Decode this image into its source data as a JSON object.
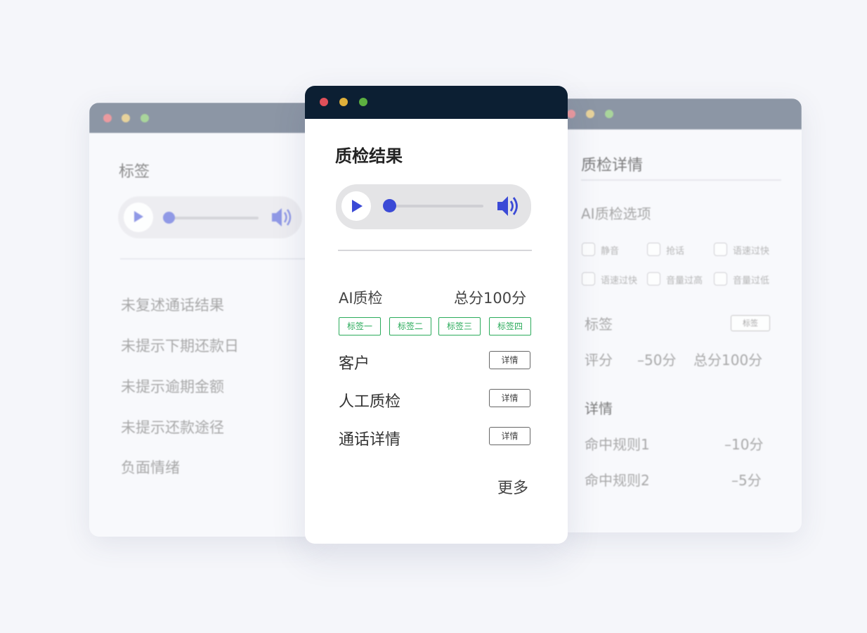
{
  "left_window": {
    "title": "标签",
    "items": [
      "未复述通话结果",
      "未提示下期还款日",
      "未提示逾期金额",
      "未提示还款途径",
      "负面情绪"
    ],
    "player_progress": 0.0
  },
  "center_window": {
    "title": "质检结果",
    "player_progress": 0.0,
    "ai_label": "AI质检",
    "total_score": "总分100分",
    "tags": [
      "标签一",
      "标签二",
      "标签三",
      "标签四"
    ],
    "rows": [
      {
        "label": "客户",
        "button": "详情"
      },
      {
        "label": "人工质检",
        "button": "详情"
      },
      {
        "label": "通话详情",
        "button": "详情"
      }
    ],
    "more": "更多"
  },
  "right_window": {
    "title": "质检详情",
    "section_title": "AI质检选项",
    "options": [
      "静音",
      "抢话",
      "语速过快",
      "语速过快",
      "音量过高",
      "音量过低"
    ],
    "tag_label": "标签",
    "tag_button": "标签",
    "score_label": "评分",
    "score_value": "–50分",
    "score_total": "总分100分",
    "detail_title": "详情",
    "rules": [
      {
        "name": "命中规则1",
        "score": "–10分"
      },
      {
        "name": "命中规则2",
        "score": "–5分"
      }
    ]
  },
  "colors": {
    "accent": "#3b4ad6",
    "tag_green": "#2bab5b",
    "dark_titlebar": "#0c1f33",
    "gray_titlebar": "#7a8596",
    "dot_red": "#e0505a",
    "dot_yellow": "#e0b03a",
    "dot_green": "#5cb040"
  },
  "icons": [
    "play-icon",
    "volume-icon",
    "checkbox-icon"
  ]
}
